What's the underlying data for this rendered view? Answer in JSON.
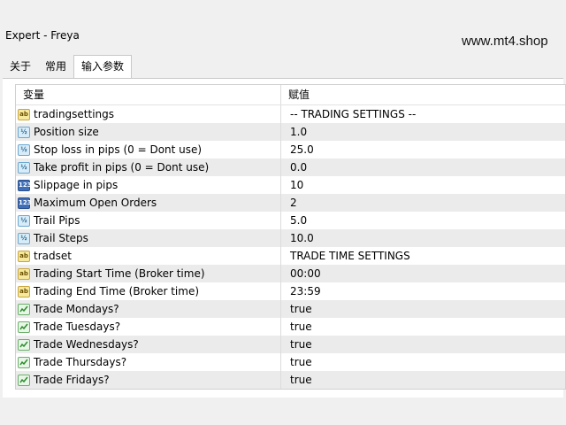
{
  "window": {
    "title": "Expert - Freya"
  },
  "watermark": "www.mt4.shop",
  "tabs": [
    {
      "label": "关于",
      "active": false
    },
    {
      "label": "常用",
      "active": false
    },
    {
      "label": "输入参数",
      "active": true
    }
  ],
  "table": {
    "headers": {
      "variable": "变量",
      "value": "赋值"
    },
    "rows": [
      {
        "icon": "string-icon",
        "name": "tradingsettings",
        "value": "-- TRADING SETTINGS --"
      },
      {
        "icon": "double-icon",
        "name": "Position size",
        "value": "1.0"
      },
      {
        "icon": "double-icon",
        "name": "Stop loss in pips (0 = Dont use)",
        "value": "25.0"
      },
      {
        "icon": "double-icon",
        "name": "Take profit in pips (0 = Dont use)",
        "value": "0.0"
      },
      {
        "icon": "integer-icon",
        "name": "Slippage in pips",
        "value": "10"
      },
      {
        "icon": "integer-icon",
        "name": "Maximum Open Orders",
        "value": "2"
      },
      {
        "icon": "double-icon",
        "name": "Trail Pips",
        "value": "5.0"
      },
      {
        "icon": "double-icon",
        "name": "Trail Steps",
        "value": "10.0"
      },
      {
        "icon": "string-icon",
        "name": "tradset",
        "value": "TRADE TIME SETTINGS"
      },
      {
        "icon": "string-icon",
        "name": "Trading Start Time (Broker time)",
        "value": "00:00"
      },
      {
        "icon": "string-icon",
        "name": "Trading End Time (Broker time)",
        "value": "23:59"
      },
      {
        "icon": "bool-icon",
        "name": "Trade Mondays?",
        "value": "true"
      },
      {
        "icon": "bool-icon",
        "name": "Trade Tuesdays?",
        "value": "true"
      },
      {
        "icon": "bool-icon",
        "name": "Trade Wednesdays?",
        "value": "true"
      },
      {
        "icon": "bool-icon",
        "name": "Trade Thursdays?",
        "value": "true"
      },
      {
        "icon": "bool-icon",
        "name": "Trade Fridays?",
        "value": "true"
      }
    ]
  }
}
